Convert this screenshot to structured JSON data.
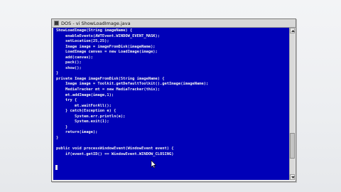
{
  "window": {
    "title": "DOS - vi ShowLoadImage.java",
    "icon": "terminal-icon"
  },
  "colors": {
    "console_background": "#0000b8",
    "console_text": "#f2f2f2",
    "desktop_background": "#eef0f3"
  },
  "editor": {
    "lines": [
      "ShowLoadImage(String imageName) {",
      "    enableEvents(AWTEvent.WINDOW_EVENT_MASK);",
      "    setLocation(25,25);",
      "    Image image = imageFromDisk(imageName);",
      "    LoadImage canvas = new LoadImage(image);",
      "    add(canvas);",
      "    pack();",
      "    show();",
      "}",
      "private Image imageFromDisk(String imageName) {",
      "    Image image = Toolkit.getDefaultToolkit().getImage(imageName);",
      "    MediaTracker mt = new MediaTracker(this);",
      "    mt.addImage(image,1);",
      "    try {",
      "        mt.waitForAll();",
      "    } catch(Exception e) {",
      "        System.err.println(e);",
      "        System.exit(1);",
      "    }",
      "    return(image);",
      "}",
      "",
      "public void processWindowEvent(WindowEvent event) {",
      "    if(event.getID() == WindowEvent.WINDOW_CLOSING)"
    ]
  }
}
